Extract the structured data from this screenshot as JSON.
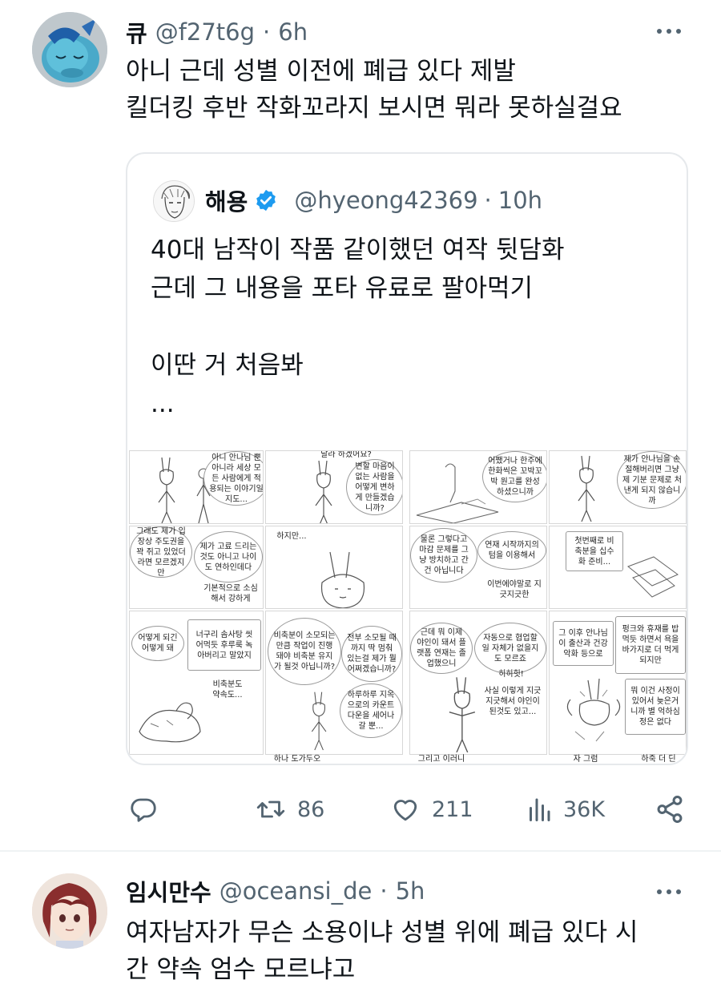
{
  "tweet1": {
    "name": "큐",
    "handle": "@f27t6g",
    "sep": "·",
    "time": "6h",
    "lines": [
      "아니 근데 성별 이전에 폐급 있다 제발",
      "킬더킹 후반 작화꼬라지 보시면 뭐라 못하실걸요"
    ],
    "avatar_icon": "blue-creature-avatar"
  },
  "quote": {
    "name": "해용",
    "verified_icon": "verified-badge-icon",
    "handle": "@hyeong42369",
    "sep": "·",
    "time": "10h",
    "lines": [
      "40대 남작이 작품 같이했던 여작 뒷담화",
      "근데 그 내용을 포타 유료로 팔아먹기",
      "",
      "이딴 거 처음봐",
      "..."
    ]
  },
  "comic": {
    "p1": [
      "아니 안나님 뿐 아니라 세상 모든 사람에게 적용되는 이야기일지도..."
    ],
    "p2": [
      "변할 마음이 없는 사람을 어떻게 변하게 만들겠습니까?",
      "달라 하겠어요?"
    ],
    "p3": [
      "어쨌거나 한주에 한화씩은 꼬박꼬박 원고를 완성 하셨으니까"
    ],
    "p4": [
      "제가 안나님을 손절해버리면 그냥 제 기분 문제로 처낸게 되지 않습니까"
    ],
    "p5": [
      "그래도 제가 입장상 주도권을 꽉 쥐고 있었더라면 모르겠지만",
      "제가 고료 드리는것도 아니고 나이도 연하인데다",
      "기본적으로 소심해서 강하게"
    ],
    "p6": [
      "하지만..."
    ],
    "p7": [
      "물론 그렇다고 마감 문제를 그냥 방치하고 간건 아닙니다",
      "연재 시작까지의 텀을 이용해서",
      "이번에야말로 지긋지긋한"
    ],
    "p8": [
      "첫번째로 비축분을 십수화 준비..."
    ],
    "p9": [
      "어떻게 되긴 어떻게 돼",
      "너구리 솜사탕 씻어먹듯 후루룩 녹아버리고 말았지",
      "비축분도 약속도..."
    ],
    "p10": [
      "비축분이 소모되는 만큼 작업이 진행돼야 비축분 유지가 될것 아닙니까?",
      "전부 소모될 때까지 딱 멈춰 있는걸 제가 뭘 어쩌겠습니까?",
      "하루하루 지옥으로의 카운트다운을 세어나갈 뿐..."
    ],
    "p11": [
      "근데 뭐 이제 야인이 돼서 플랫폼 연재는 졸업했으니",
      "자동으로 협업할 일 자체가 없을지도 모르죠",
      "히히힛!",
      "사실 이렇게 지긋지긋해서 야인이 된것도 있고..."
    ],
    "p12": [
      "그 이후 안나님이 출산과 건강 악화 등으로",
      "펑크와 휴재를 밥먹듯 하면서 욕을 바가지로 더 먹게되지만",
      "뭐 이건 사정이 있어서 늦은거니까 별 억하심정은 없다"
    ],
    "bottom": [
      "하나 도가두오",
      "그리고 이러니",
      "자 그럼",
      "하죽 더 딘"
    ]
  },
  "actions": {
    "reply_icon": "reply-icon",
    "retweet_icon": "retweet-icon",
    "retweets": "86",
    "like_icon": "heart-icon",
    "likes": "211",
    "views_icon": "views-icon",
    "views": "36K",
    "share_icon": "share-icon"
  },
  "tweet2": {
    "name": "임시만수",
    "handle": "@oceansi_de",
    "sep": "·",
    "time": "5h",
    "lines": [
      "여자남자가 무슨 소용이냐 성별 위에 폐급 있다 시",
      "간 약속 엄수 모르냐고"
    ],
    "avatar_icon": "anime-girl-avatar"
  },
  "colors": {
    "text": "#0f1419",
    "muted": "#536471",
    "verified": "#1d9bf0",
    "border": "#e6e9ec"
  }
}
